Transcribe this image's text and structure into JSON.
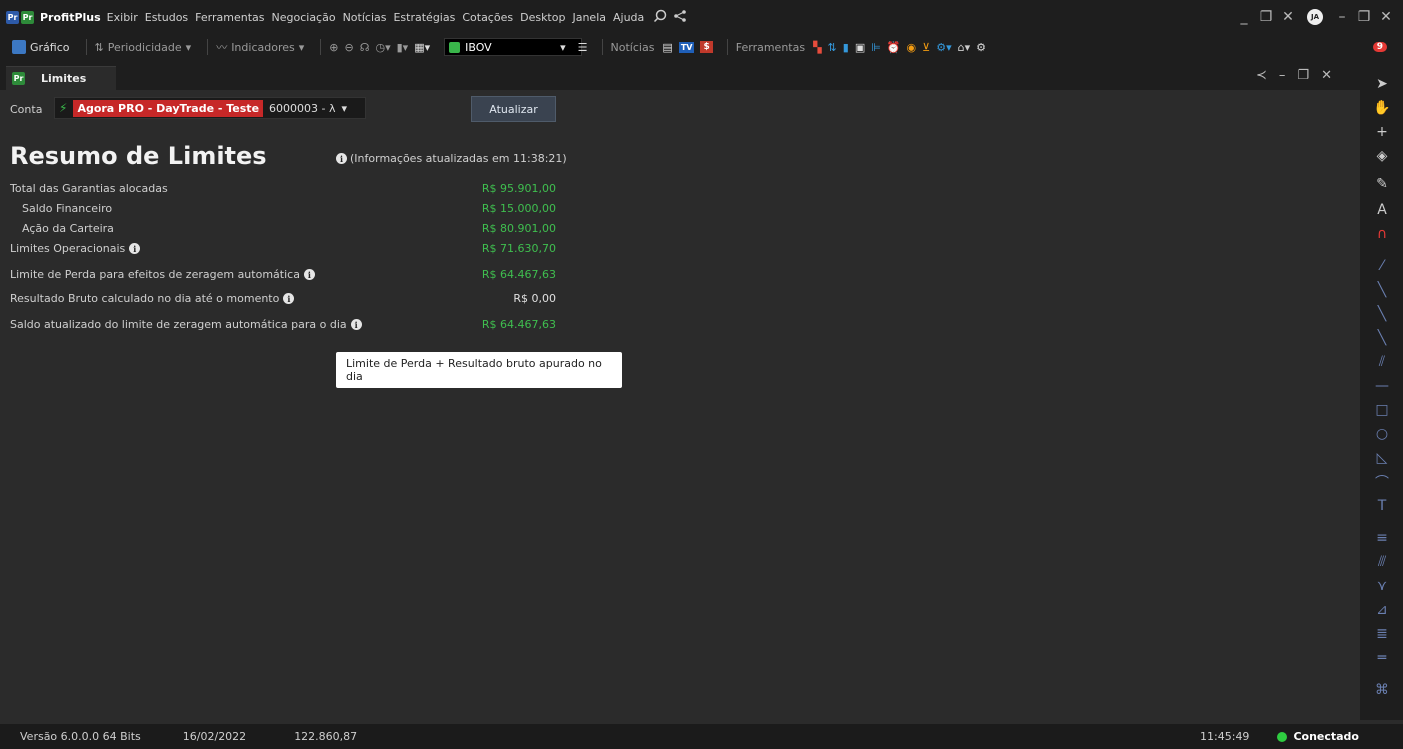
{
  "app": {
    "name": "ProfitPlus",
    "logo_a": "Pr",
    "logo_b": "Pr",
    "menu": [
      "Exibir",
      "Estudos",
      "Ferramentas",
      "Negociação",
      "Notícias",
      "Estratégias",
      "Cotações",
      "Desktop",
      "Janela",
      "Ajuda"
    ],
    "user_initials": "JA",
    "notification_count": "9"
  },
  "toolbar": {
    "chart_label": "Gráfico",
    "period_label": "Periodicidade",
    "indicators_label": "Indicadores",
    "symbol": "IBOV",
    "news_label": "Notícias",
    "tv_label": "TV",
    "tools_label": "Ferramentas"
  },
  "tab": {
    "logo": "Pr",
    "label": "Limites"
  },
  "form": {
    "conta_label": "Conta",
    "account_name": "Agora PRO - DayTrade - Teste",
    "account_id": "6000003 - λ",
    "refresh_label": "Atualizar"
  },
  "summary": {
    "title": "Resumo de Limites",
    "updated_text": "(Informações atualizadas em 11:38:21)",
    "rows": [
      {
        "label": "Total das Garantias alocadas",
        "value": "R$ 95.901,00"
      },
      {
        "label": "Saldo Financeiro",
        "value": "R$ 15.000,00"
      },
      {
        "label": "Ação da Carteira",
        "value": "R$ 80.901,00"
      },
      {
        "label": "Limites Operacionais",
        "value": "R$ 71.630,70"
      },
      {
        "label": "Limite de Perda para efeitos de zeragem automática",
        "value": "R$ 64.467,63"
      },
      {
        "label": "Resultado Bruto calculado no dia até o momento",
        "value": "R$ 0,00"
      },
      {
        "label": "Saldo atualizado do limite de zeragem automática para o dia",
        "value": "R$ 64.467,63"
      }
    ],
    "tooltip": "Limite de Perda + Resultado bruto apurado no dia"
  },
  "status": {
    "version": "Versão 6.0.0.0 64 Bits",
    "date": "16/02/2022",
    "index_value": "122.860,87",
    "time": "11:45:49",
    "connection": "Conectado"
  },
  "colors": {
    "positive": "#3fbf4f",
    "account_badge": "#c62828",
    "connected": "#2ecc40"
  }
}
